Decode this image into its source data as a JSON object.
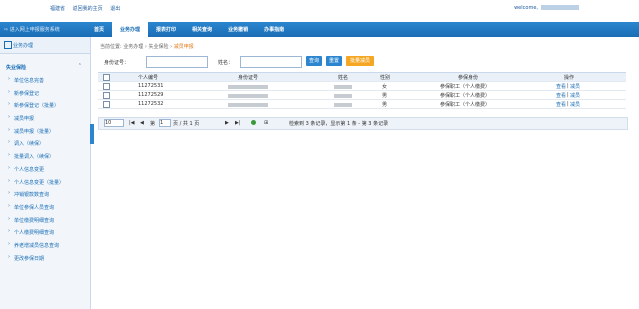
{
  "topbar": {
    "link_province": "福建省",
    "link_home": "返回我的主页",
    "link_logout": "退出",
    "welcome_prefix": "welcome,"
  },
  "navbar": {
    "notice": "进入网上申报服务系统",
    "tabs": [
      "首页",
      "业务办理",
      "报表打印",
      "相关查询",
      "业务撤销",
      "办事指南"
    ],
    "active_tab": "业务办理"
  },
  "sidebar": {
    "header": "业务办理",
    "section_title": "失业保险",
    "collapse_symbol": "⌃",
    "items": [
      "单位信息完善",
      "新参保登记",
      "新参保登记（批量）",
      "减员申报",
      "减员申报（批量）",
      "调入（续保）",
      "批量调入（续保）",
      "个人信息变更",
      "个人信息变更（批量）",
      "冲销银款数查询",
      "单位参保人员查询",
      "单位缴费明细查询",
      "个人缴费明细查询",
      "养老增减员信息查询",
      "更改参保日期"
    ]
  },
  "breadcrumb": {
    "label": "当前位置:",
    "items": [
      "业务办理",
      "失业保险",
      "减员申报"
    ]
  },
  "form": {
    "id_label": "身份证号：",
    "name_label": "姓名：",
    "query_btn": "查询",
    "reset_btn": "重置",
    "batch_btn": "批量减员"
  },
  "table": {
    "headers": [
      "个人编号",
      "身份证号",
      "姓名",
      "性别",
      "参保身份",
      "操作"
    ],
    "rows": [
      {
        "no": "11272531",
        "gender": "女",
        "identity": "参保职工（个人缴费）",
        "op_view": "查看",
        "op_reduce": "减员"
      },
      {
        "no": "11272529",
        "gender": "男",
        "identity": "参保职工（个人缴费）",
        "op_view": "查看",
        "op_reduce": "减员"
      },
      {
        "no": "11272532",
        "gender": "男",
        "identity": "参保职工（个人缴费）",
        "op_view": "查看",
        "op_reduce": "减员"
      }
    ]
  },
  "pager": {
    "page_size": "10",
    "page_label_before": "第",
    "page_value": "1",
    "page_label_after": "页 / 共 1 页",
    "info_left": "检索到 3 条记录，显示第 1 条 - 第 3 条记录",
    "first_symbol": "|◀",
    "prev_symbol": "◀",
    "next_symbol": "▶",
    "last_symbol": "▶|"
  },
  "colors": {
    "nav": "#1a6db5",
    "accent_orange": "#f5a623",
    "link": "#1a6db5"
  }
}
